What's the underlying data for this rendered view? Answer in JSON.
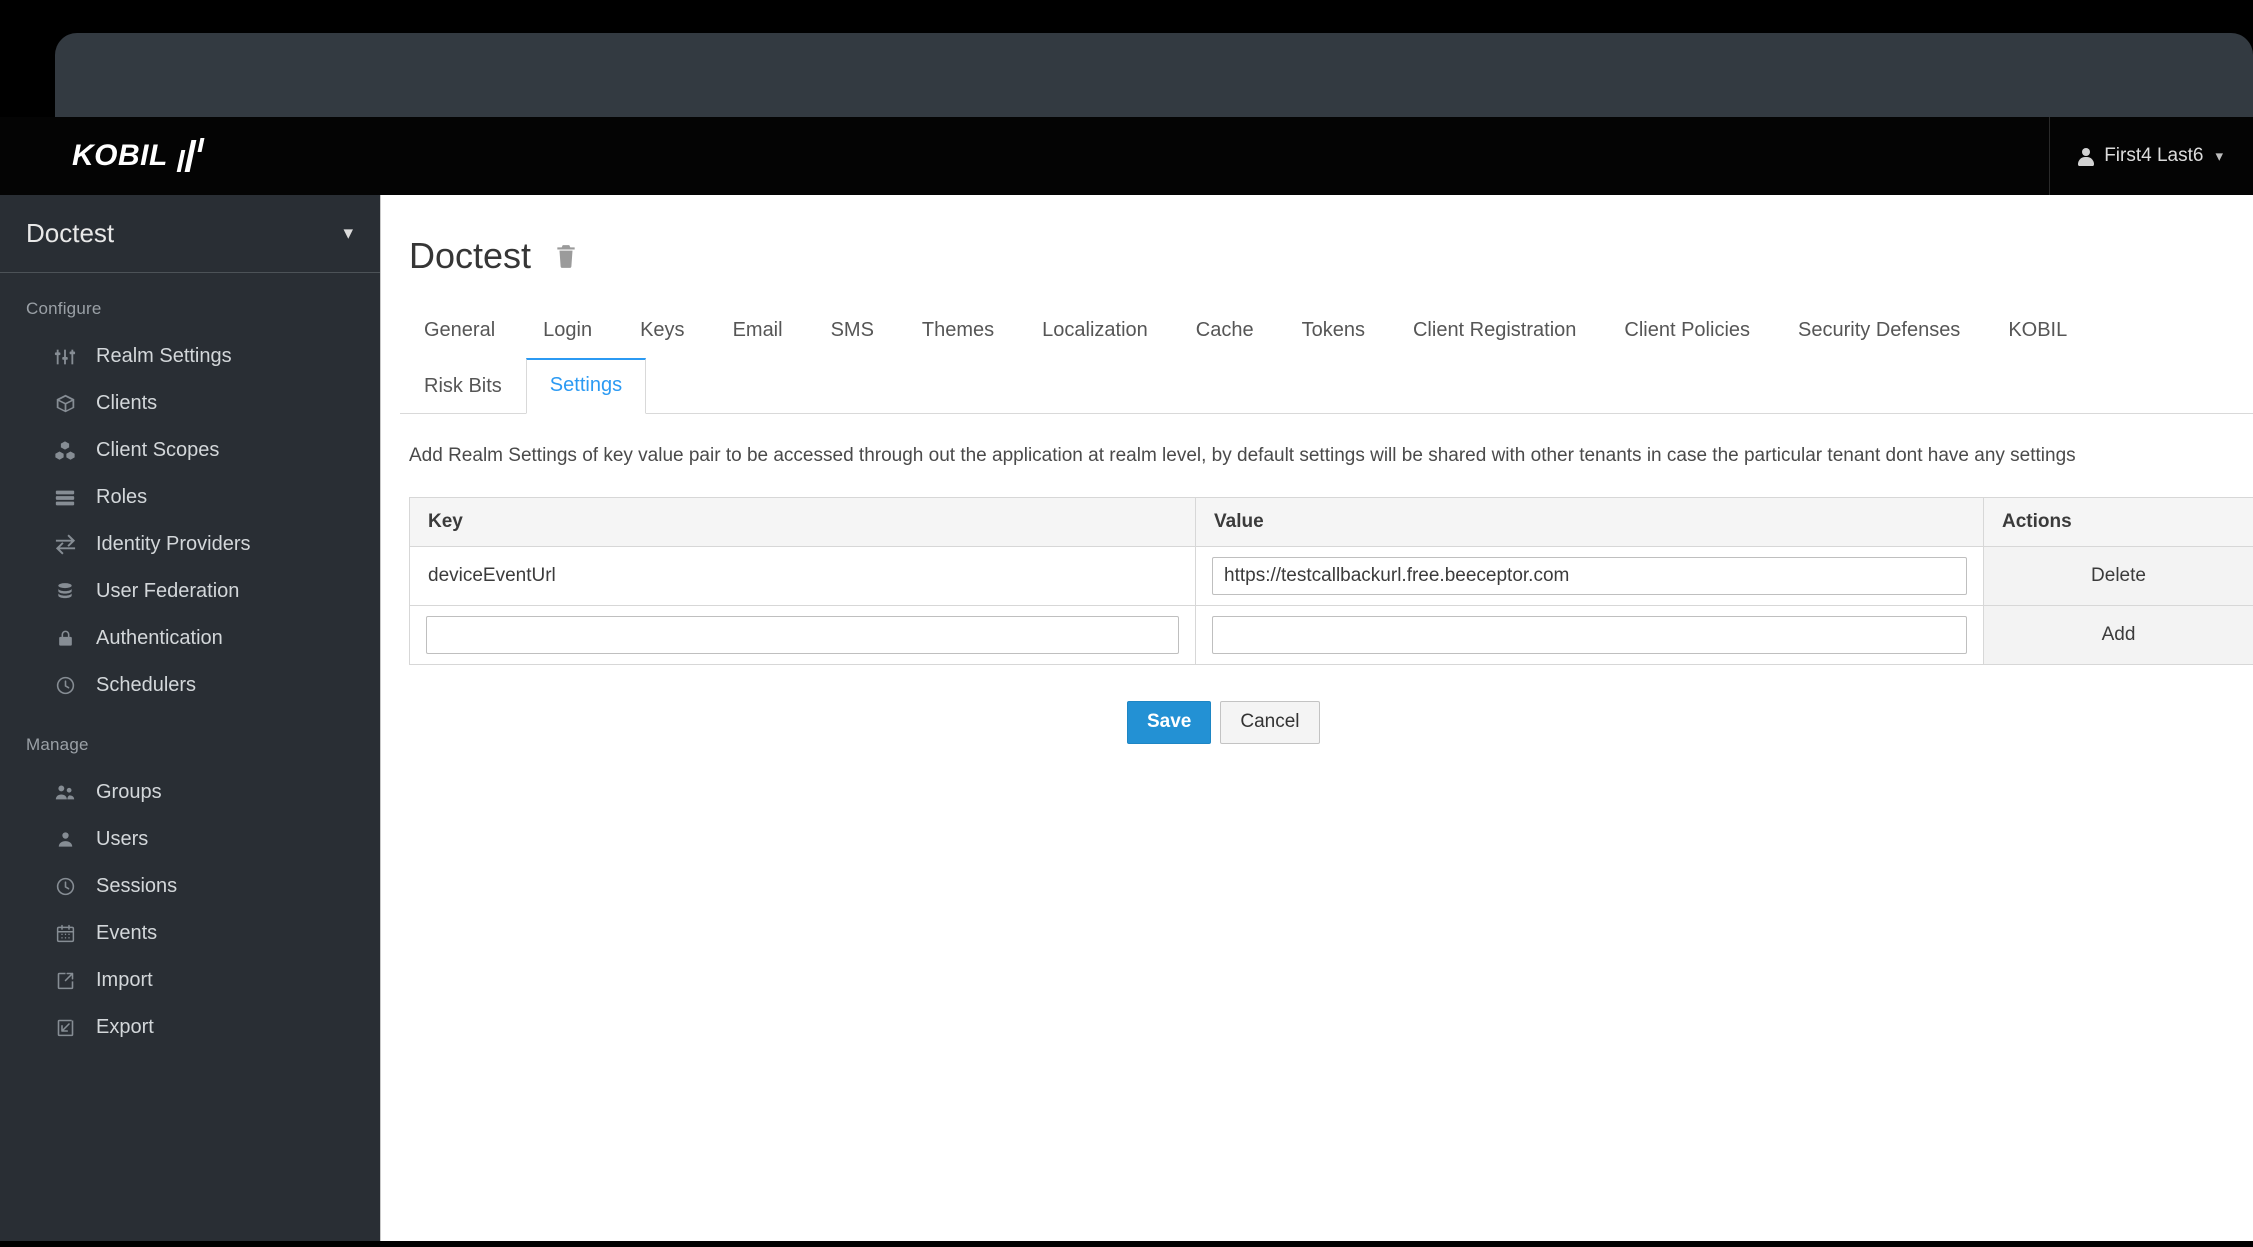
{
  "navbar": {
    "brand_text": "KOBIL",
    "brand_mark_icon": "kobil-bars-logo",
    "user_name": "First4 Last6",
    "user_caret_icon": "chevron-down-icon",
    "avatar_icon": "user-avatar-icon"
  },
  "sidebar": {
    "realm_name": "Doctest",
    "realm_caret_icon": "chevron-down-icon",
    "sections": [
      {
        "title": "Configure",
        "items": [
          {
            "label": "Realm Settings",
            "icon": "sliders-icon"
          },
          {
            "label": "Clients",
            "icon": "cube-icon"
          },
          {
            "label": "Client Scopes",
            "icon": "cubes-icon"
          },
          {
            "label": "Roles",
            "icon": "list-rows-icon"
          },
          {
            "label": "Identity Providers",
            "icon": "exchange-arrows-icon"
          },
          {
            "label": "User Federation",
            "icon": "database-icon"
          },
          {
            "label": "Authentication",
            "icon": "lock-icon"
          },
          {
            "label": "Schedulers",
            "icon": "clock-icon"
          }
        ]
      },
      {
        "title": "Manage",
        "items": [
          {
            "label": "Groups",
            "icon": "users-group-icon"
          },
          {
            "label": "Users",
            "icon": "user-icon"
          },
          {
            "label": "Sessions",
            "icon": "clock-icon"
          },
          {
            "label": "Events",
            "icon": "calendar-icon"
          },
          {
            "label": "Import",
            "icon": "import-arrow-icon"
          },
          {
            "label": "Export",
            "icon": "export-arrow-icon"
          }
        ]
      }
    ]
  },
  "main": {
    "page_title": "Doctest",
    "delete_realm_icon": "trash-icon",
    "tabs_row1": [
      {
        "label": "General",
        "active": false
      },
      {
        "label": "Login",
        "active": false
      },
      {
        "label": "Keys",
        "active": false
      },
      {
        "label": "Email",
        "active": false
      },
      {
        "label": "SMS",
        "active": false
      },
      {
        "label": "Themes",
        "active": false
      },
      {
        "label": "Localization",
        "active": false
      },
      {
        "label": "Cache",
        "active": false
      },
      {
        "label": "Tokens",
        "active": false
      },
      {
        "label": "Client Registration",
        "active": false
      },
      {
        "label": "Client Policies",
        "active": false
      },
      {
        "label": "Security Defenses",
        "active": false
      },
      {
        "label": "KOBIL",
        "active": false
      }
    ],
    "tabs_row2": [
      {
        "label": "Risk Bits",
        "active": false
      },
      {
        "label": "Settings",
        "active": true
      }
    ],
    "description": "Add Realm Settings of key value pair to be accessed through out the application at realm level, by default settings will be shared with other tenants in case the particular tenant dont have any settings",
    "table": {
      "columns": [
        "Key",
        "Value",
        "Actions"
      ],
      "rows": [
        {
          "key_text": "deviceEventUrl",
          "key_input_value": "",
          "key_is_input": false,
          "value_input_value": "https://testcallbackurl.free.beeceptor.com",
          "value_placeholder": "",
          "action_label": "Delete"
        },
        {
          "key_text": "",
          "key_input_value": "",
          "key_is_input": true,
          "value_input_value": "",
          "value_placeholder": "",
          "action_label": "Add"
        }
      ]
    },
    "buttons": {
      "save_label": "Save",
      "cancel_label": "Cancel"
    }
  },
  "colors": {
    "accent": "#2b9af3",
    "primary_button": "#2391d4",
    "sidebar_bg": "#292e34",
    "navbar_bg": "#040404",
    "chrome_bg": "#333a41"
  }
}
